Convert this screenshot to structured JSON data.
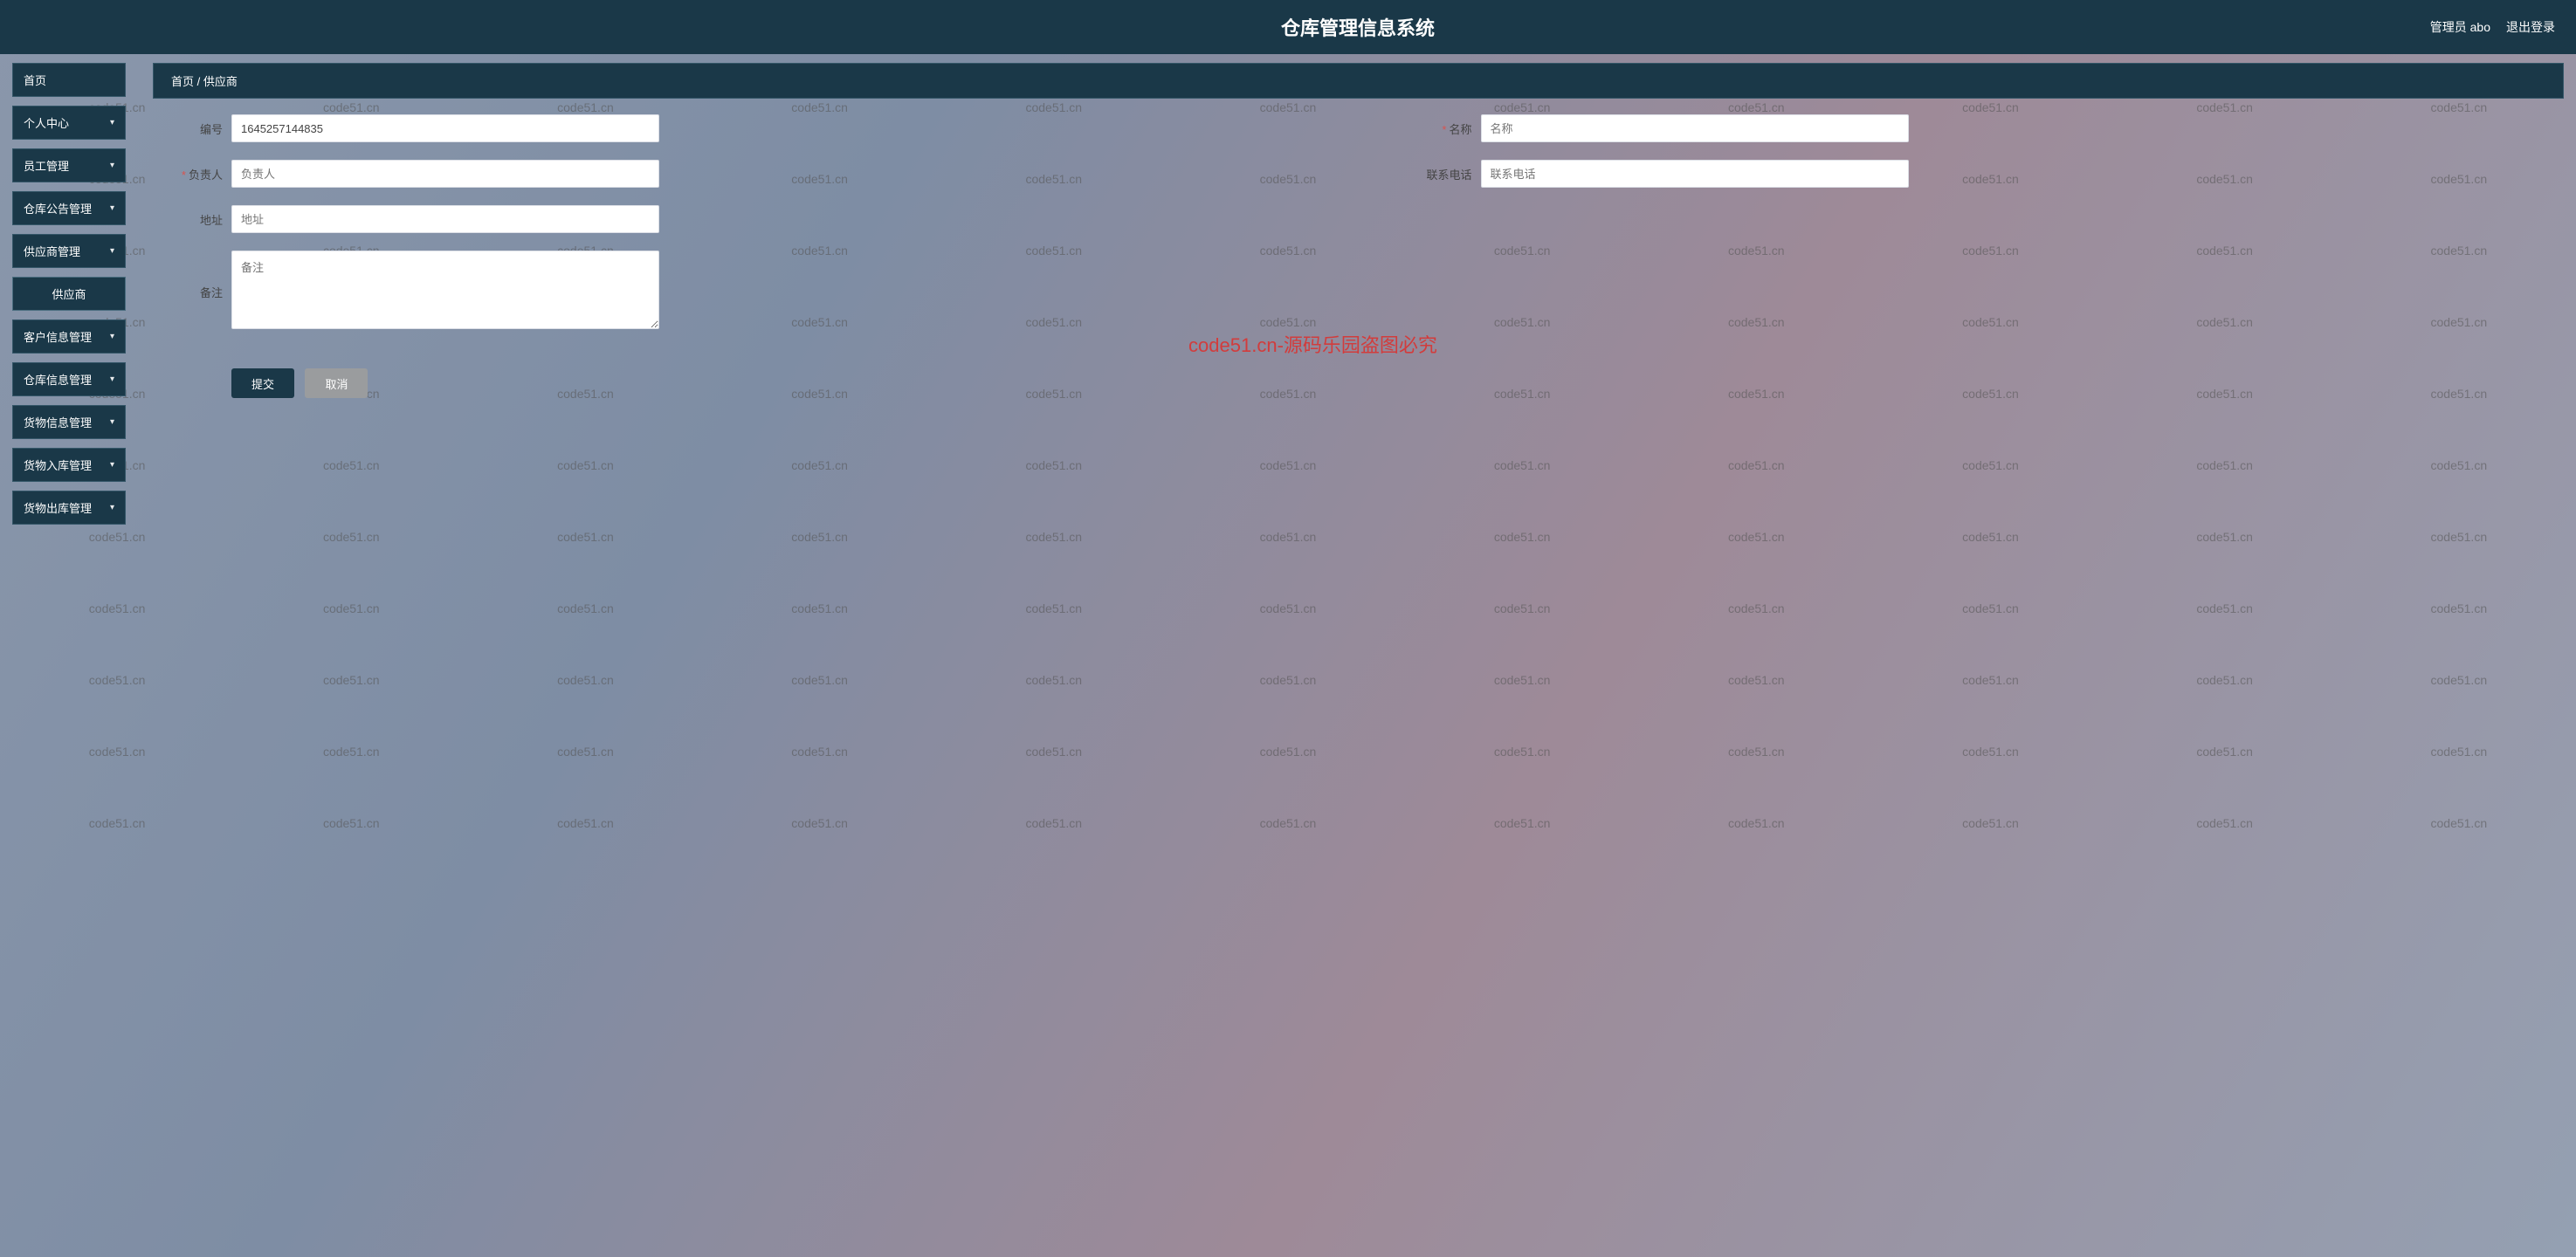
{
  "header": {
    "title": "仓库管理信息系统",
    "user_label": "管理员 abo",
    "logout": "退出登录"
  },
  "sidebar": {
    "items": [
      {
        "label": "首页",
        "expandable": false
      },
      {
        "label": "个人中心",
        "expandable": true
      },
      {
        "label": "员工管理",
        "expandable": true
      },
      {
        "label": "仓库公告管理",
        "expandable": true
      },
      {
        "label": "供应商管理",
        "expandable": true
      },
      {
        "label": "供应商",
        "expandable": false,
        "sub": true
      },
      {
        "label": "客户信息管理",
        "expandable": true
      },
      {
        "label": "仓库信息管理",
        "expandable": true
      },
      {
        "label": "货物信息管理",
        "expandable": true
      },
      {
        "label": "货物入库管理",
        "expandable": true
      },
      {
        "label": "货物出库管理",
        "expandable": true
      }
    ]
  },
  "breadcrumb": {
    "home": "首页",
    "sep": "/",
    "current": "供应商"
  },
  "form": {
    "no_label": "编号",
    "no_value": "1645257144835",
    "name_label": "名称",
    "name_placeholder": "名称",
    "name_value": "",
    "owner_label": "负责人",
    "owner_placeholder": "负责人",
    "owner_value": "",
    "phone_label": "联系电话",
    "phone_placeholder": "联系电话",
    "phone_value": "",
    "addr_label": "地址",
    "addr_placeholder": "地址",
    "addr_value": "",
    "remark_label": "备注",
    "remark_placeholder": "备注",
    "remark_value": ""
  },
  "actions": {
    "submit": "提交",
    "cancel": "取消"
  },
  "watermark": {
    "small": "code51.cn",
    "big": "code51.cn-源码乐园盗图必究"
  }
}
